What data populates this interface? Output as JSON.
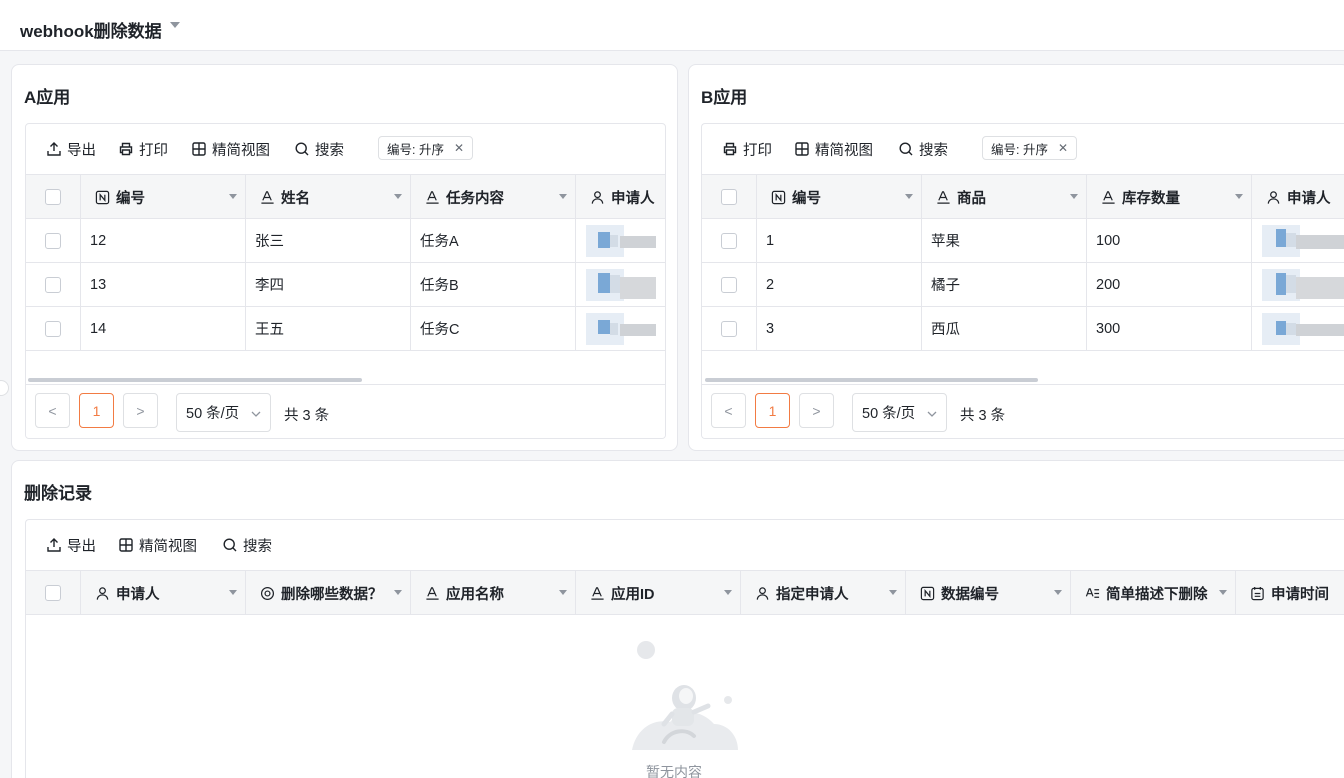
{
  "page": {
    "title": "webhook删除数据"
  },
  "card_a": {
    "title": "A应用",
    "toolbar": {
      "export": "导出",
      "print": "打印",
      "compact_view": "精简视图",
      "search": "搜索",
      "sort_tag": "编号: 升序"
    },
    "columns": [
      "编号",
      "姓名",
      "任务内容",
      "申请人"
    ],
    "rows": [
      {
        "id": "12",
        "name": "张三",
        "task": "任务A"
      },
      {
        "id": "13",
        "name": "李四",
        "task": "任务B"
      },
      {
        "id": "14",
        "name": "王五",
        "task": "任务C"
      }
    ],
    "pager": {
      "prev": "<",
      "page": "1",
      "next": ">",
      "page_size": "50 条/页",
      "total": "共 3 条"
    }
  },
  "card_b": {
    "title": "B应用",
    "toolbar": {
      "print": "打印",
      "compact_view": "精简视图",
      "search": "搜索",
      "sort_tag": "编号: 升序"
    },
    "columns": [
      "编号",
      "商品",
      "库存数量",
      "申请人"
    ],
    "rows": [
      {
        "id": "1",
        "product": "苹果",
        "stock": "100"
      },
      {
        "id": "2",
        "product": "橘子",
        "stock": "200"
      },
      {
        "id": "3",
        "product": "西瓜",
        "stock": "300"
      }
    ],
    "pager": {
      "prev": "<",
      "page": "1",
      "next": ">",
      "page_size": "50 条/页",
      "total": "共 3 条"
    }
  },
  "card_c": {
    "title": "删除记录",
    "toolbar": {
      "export": "导出",
      "compact_view": "精简视图",
      "search": "搜索"
    },
    "columns": [
      "申请人",
      "删除哪些数据？",
      "应用名称",
      "应用ID",
      "指定申请人",
      "数据编号",
      "简单描述下删除",
      "申请时间"
    ],
    "empty_text": "暂无内容"
  },
  "colors": {
    "accent": "#f27b43",
    "border": "#e5e6eb",
    "header_bg": "#f5f6f7"
  }
}
